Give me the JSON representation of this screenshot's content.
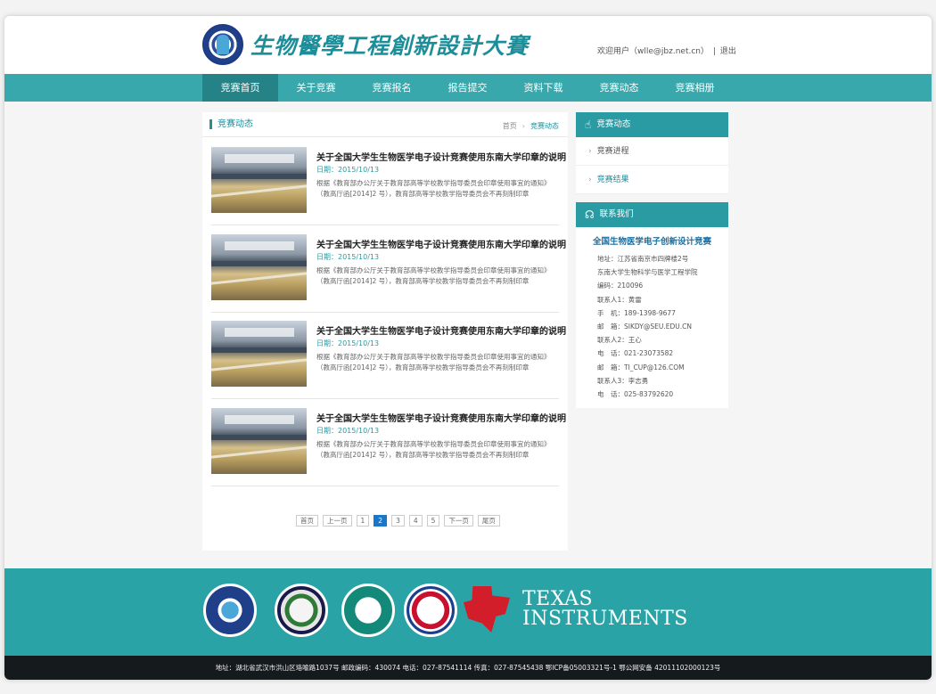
{
  "header": {
    "logo_text": "生物醫學工程創新設計大賽",
    "user_greeting": "欢迎用户（wlle@jbz.net.cn）",
    "separator": "|",
    "logout": "退出"
  },
  "nav": {
    "items": [
      "竞赛首页",
      "关于竞赛",
      "竞赛报名",
      "报告提交",
      "资料下载",
      "竞赛动态",
      "竞赛相册"
    ],
    "active_index": 0
  },
  "content": {
    "title": "竞赛动态",
    "breadcrumb": {
      "home": "首页",
      "arrow": "›",
      "current": "竞赛动态"
    },
    "articles": [
      {
        "title": "关于全国大学生生物医学电子设计竞赛使用东南大学印章的说明",
        "date": "日期：2015/10/13",
        "desc": "根据《教育部办公厅关于教育部高等学校教学指导委员会印章使用事宜的通知》（教高厅函[2014]2 号），教育部高等学校教学指导委员会不再刻制印章"
      },
      {
        "title": "关于全国大学生生物医学电子设计竞赛使用东南大学印章的说明",
        "date": "日期：2015/10/13",
        "desc": "根据《教育部办公厅关于教育部高等学校教学指导委员会印章使用事宜的通知》（教高厅函[2014]2 号），教育部高等学校教学指导委员会不再刻制印章"
      },
      {
        "title": "关于全国大学生生物医学电子设计竞赛使用东南大学印章的说明",
        "date": "日期：2015/10/13",
        "desc": "根据《教育部办公厅关于教育部高等学校教学指导委员会印章使用事宜的通知》（教高厅函[2014]2 号），教育部高等学校教学指导委员会不再刻制印章"
      },
      {
        "title": "关于全国大学生生物医学电子设计竞赛使用东南大学印章的说明",
        "date": "日期：2015/10/13",
        "desc": "根据《教育部办公厅关于教育部高等学校教学指导委员会印章使用事宜的通知》（教高厅函[2014]2 号），教育部高等学校教学指导委员会不再刻制印章"
      }
    ],
    "pager": [
      "首页",
      "上一页",
      "1",
      "2",
      "3",
      "4",
      "5",
      "下一页",
      "尾页"
    ],
    "pager_current": "2"
  },
  "sidebar": {
    "news_title": "竞赛动态",
    "news_items": [
      "竞赛进程",
      "竞赛结果"
    ],
    "news_active": 1,
    "contact_title": "联系我们",
    "contact_org": "全国生物医学电子创新设计竞赛",
    "contact_lines": [
      "地址：江苏省南京市四牌楼2号",
      "东南大学生物科学与医学工程学院",
      "编码：210096",
      "联系人1：黄雷",
      "手　机：189-1398-9677",
      "邮　箱：SIKDY@SEU.EDU.CN",
      "联系人2：王心",
      "电　话：021-23073582",
      "邮　箱：TI_CUP@126.COM",
      "联系人3：李志勇",
      "电　话：025-83792620"
    ]
  },
  "footer": {
    "ti_line1": "TEXAS",
    "ti_line2": "INSTRUMENTS",
    "copyright": "地址：湖北省武汉市洪山区珞喻路1037号  邮政编码：430074   电话：027-87541114   传真：027-87545438   鄂ICP备05003321号-1     鄂公网安备 42011102000123号"
  },
  "colors": {
    "teal": "#39a8ac",
    "teal_dark": "#258286",
    "accent_blue": "#1976c8",
    "footer_teal": "#2aa3a7"
  }
}
